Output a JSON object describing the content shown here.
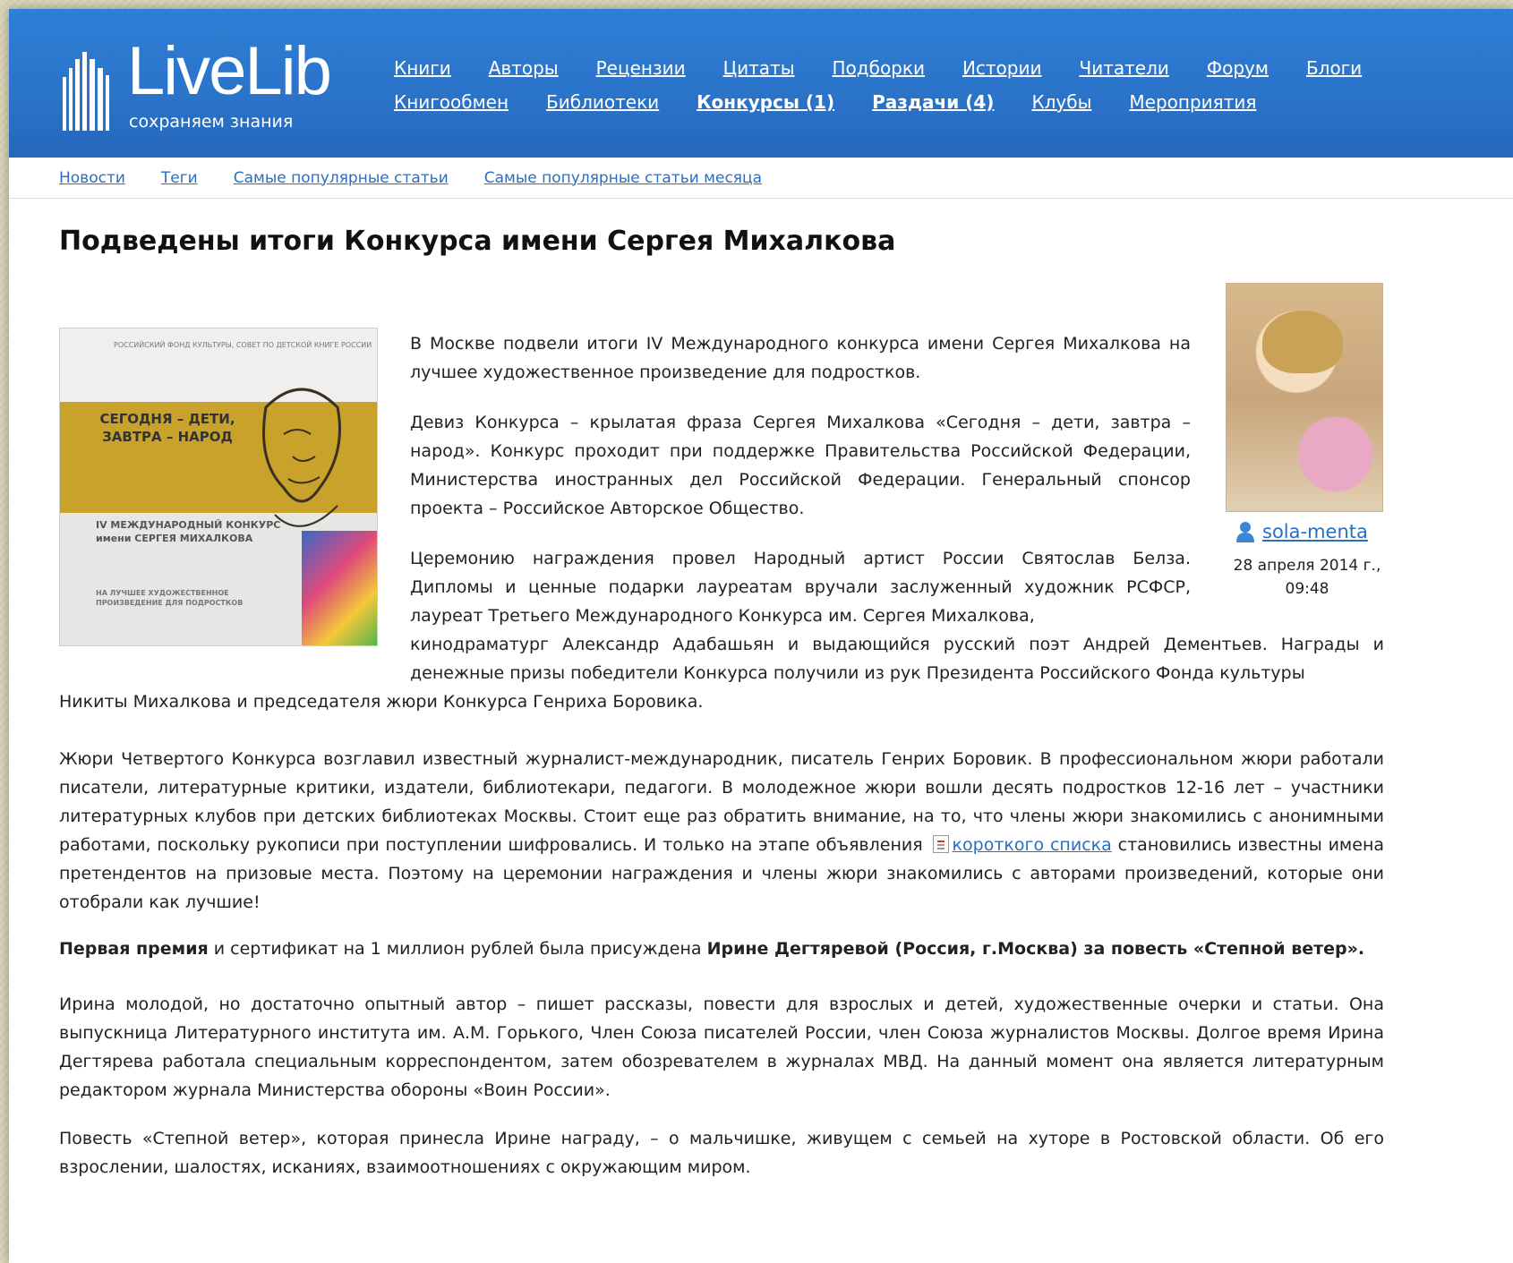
{
  "header": {
    "logo_name": "LiveLib",
    "logo_tagline": "сохраняем знания",
    "nav_row1": [
      {
        "label": "Книги"
      },
      {
        "label": "Авторы"
      },
      {
        "label": "Рецензии"
      },
      {
        "label": "Цитаты"
      },
      {
        "label": "Подборки"
      },
      {
        "label": "Истории"
      },
      {
        "label": "Читатели"
      },
      {
        "label": "Форум"
      },
      {
        "label": "Блоги"
      }
    ],
    "nav_row2": [
      {
        "label": "Книгообмен"
      },
      {
        "label": "Библиотеки"
      },
      {
        "label": "Конкурсы (1)"
      },
      {
        "label": "Раздачи (4)"
      },
      {
        "label": "Клубы"
      },
      {
        "label": "Мероприятия"
      }
    ]
  },
  "subnav": [
    {
      "label": "Новости"
    },
    {
      "label": "Теги"
    },
    {
      "label": "Самые популярные статьи"
    },
    {
      "label": "Самые популярные статьи месяца"
    }
  ],
  "article": {
    "title": "Подведены итоги Конкурса имени Сергея Михалкова",
    "author": "sola-menta",
    "date_line1": "28 апреля 2014 г.,",
    "date_line2": "09:48",
    "cover": {
      "top_line": "РОССИЙСКИЙ ФОНД КУЛЬТУРЫ, СОВЕТ ПО ДЕТСКОЙ КНИГЕ РОССИИ",
      "slogan": "СЕГОДНЯ – ДЕТИ, ЗАВТРА – НАРОД",
      "contest": "IV МЕЖДУНАРОДНЫЙ КОНКУРС имени СЕРГЕЯ МИХАЛКОВА",
      "sub": "НА ЛУЧШЕЕ ХУДОЖЕСТВЕННОЕ ПРОИЗВЕДЕНИЕ ДЛЯ ПОДРОСТКОВ"
    },
    "p1": "В Москве подвели итоги IV Международного конкурса имени Сергея Михалкова на лучшее художественное произведение для подростков.",
    "p2": "Девиз Конкурса – крылатая фраза Сергея Михалкова «Сегодня – дети, завтра – народ». Конкурс проходит при поддержке Правительства Российской Федерации, Министерства иностранных дел Российской Федерации. Генеральный спонсор проекта – Российское Авторское Общество.",
    "p3a": "Церемонию награждения провел Народный артист России Святослав Белза. Дипломы и ценные подарки лауреатам вручали заслуженный художник РСФСР, лауреат Третьего Международного Конкурса им. Сергея Михалкова,",
    "p3b": "кинодраматург Александр Адабашьян и выдающийся русский поэт Андрей Дементьев. Награды и денежные призы победители Конкурса получили из рук Президента Российского Фонда культуры",
    "p3c": "Никиты Михалкова и председателя жюри Конкурса Генриха Боровика.",
    "p4_before": "Жюри Четвертого Конкурса возглавил известный журналист-международник, писатель Генрих Боровик. В профессиональном жюри работали писатели, литературные критики, издатели, библиотекари, педагоги. В молодежное жюри вошли десять подростков 12-16 лет – участники литературных клубов при детских библиотеках Москвы. Стоит еще раз обратить внимание, на то, что члены жюри знакомились с анонимными работами, поскольку рукописи при поступлении шифровались. И только на этапе объявления",
    "p4_link": "короткого списка",
    "p4_after": "становились известны имена претендентов на призовые места. Поэтому на церемонии награждения и члены жюри знакомились с авторами произведений, которые они отобрали как лучшие!",
    "p5_b1": "Первая премия",
    "p5_mid": " и сертификат на 1 миллион рублей была присуждена ",
    "p5_b2": "Ирине Дегтяревой (Россия, г.Москва) за повесть «Степной ветер».",
    "p6": "Ирина молодой, но достаточно опытный автор – пишет рассказы, повести для взрослых и детей, художественные очерки и статьи. Она выпускница Литературного института им. А.М. Горького, Член Союза писателей России, член Союза журналистов Москвы. Долгое время Ирина Дегтярева работала специальным корреспондентом, затем обозревателем в журналах МВД. На данный момент она является литературным редактором журнала Министерства обороны «Воин России».",
    "p7": "Повесть «Степной ветер», которая принесла Ирине награду, – о мальчишке, живущем с семьей на хуторе в Ростовской области. Об его взрослении, шалостях, исканиях, взаимоотношениях с окружающим миром."
  }
}
